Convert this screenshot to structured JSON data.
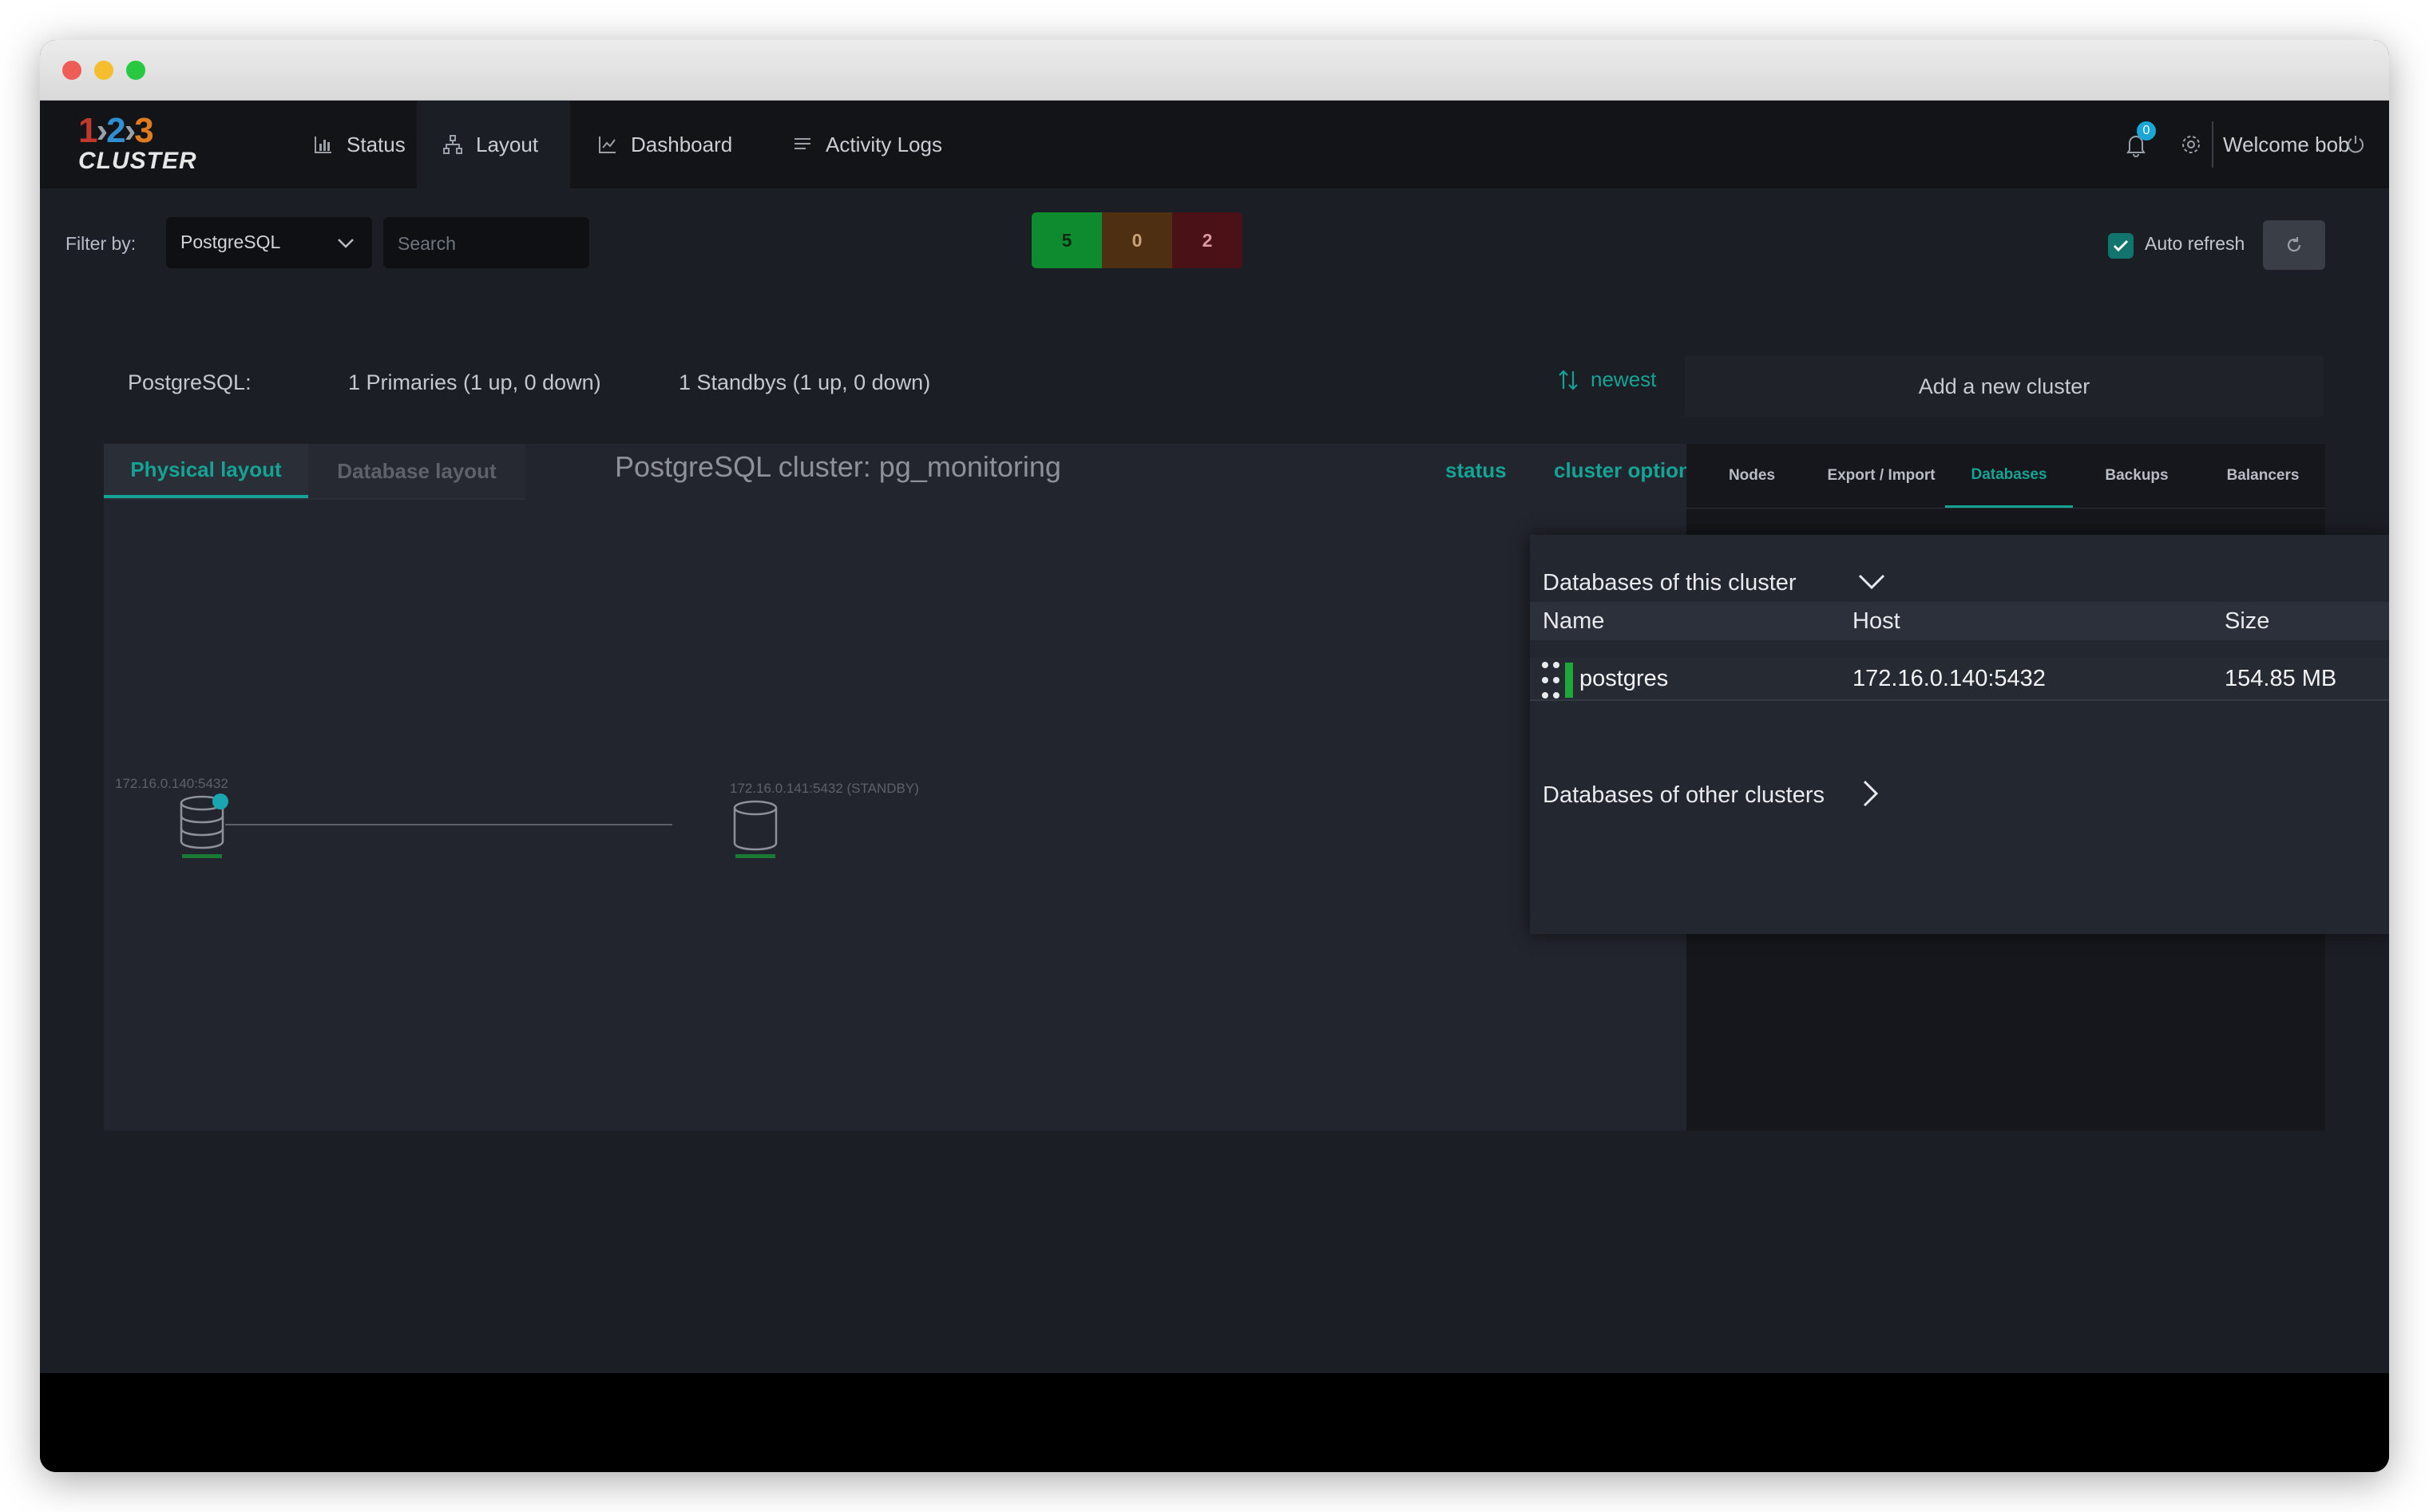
{
  "window": {
    "traffic_lights": {
      "close": "#ee5c56",
      "minimize": "#f6bd2f",
      "zoom": "#28c840"
    }
  },
  "logo": {
    "numbers": [
      "1",
      "2",
      "3"
    ],
    "word": "CLUSTER",
    "colors": {
      "one": "#c0392b",
      "two": "#2f8fd0",
      "three": "#e07b1f"
    }
  },
  "nav": {
    "items": [
      {
        "label": "Status",
        "icon": "bar-chart-icon"
      },
      {
        "label": "Layout",
        "icon": "sitemap-icon",
        "active": true
      },
      {
        "label": "Dashboard",
        "icon": "line-chart-icon"
      },
      {
        "label": "Activity Logs",
        "icon": "list-icon"
      }
    ],
    "notification_count": "0",
    "welcome": "Welcome bob"
  },
  "filter": {
    "label": "Filter by:",
    "selected": "PostgreSQL",
    "search_placeholder": "Search",
    "counts": [
      {
        "value": "5",
        "color": "#0e8a2f"
      },
      {
        "value": "0",
        "color": "#4f2f12"
      },
      {
        "value": "2",
        "color": "#4a1216"
      }
    ],
    "auto_refresh_label": "Auto refresh",
    "auto_refresh_checked": true
  },
  "summary": {
    "type": "PostgreSQL:",
    "primaries": "1 Primaries (1 up, 0 down)",
    "standbys": "1 Standbys (1 up, 0 down)"
  },
  "sort": {
    "label": "newest"
  },
  "add_cluster": {
    "label": "Add a new cluster"
  },
  "layout_tabs": [
    {
      "label": "Physical layout",
      "active": true
    },
    {
      "label": "Database layout",
      "active": false
    }
  ],
  "cluster": {
    "title": "PostgreSQL cluster: pg_monitoring",
    "status_link": "status",
    "options_link": "cluster options",
    "nodes": [
      {
        "label": "172.16.0.140:5432",
        "role": "primary"
      },
      {
        "label": "172.16.0.141:5432 (STANDBY)",
        "role": "standby"
      }
    ]
  },
  "side_tabs": [
    {
      "label": "Nodes"
    },
    {
      "label": "Export / Import"
    },
    {
      "label": "Databases",
      "active": true
    },
    {
      "label": "Backups"
    },
    {
      "label": "Balancers"
    }
  ],
  "databases_panel": {
    "this_cluster_heading": "Databases of this cluster",
    "columns": [
      "Name",
      "Host",
      "Size"
    ],
    "rows": [
      {
        "name": "postgres",
        "host": "172.16.0.140:5432",
        "size": "154.85 MB",
        "status_color": "#1fa83a"
      }
    ],
    "other_clusters_heading": "Databases of other clusters"
  },
  "accent": "#14a394"
}
